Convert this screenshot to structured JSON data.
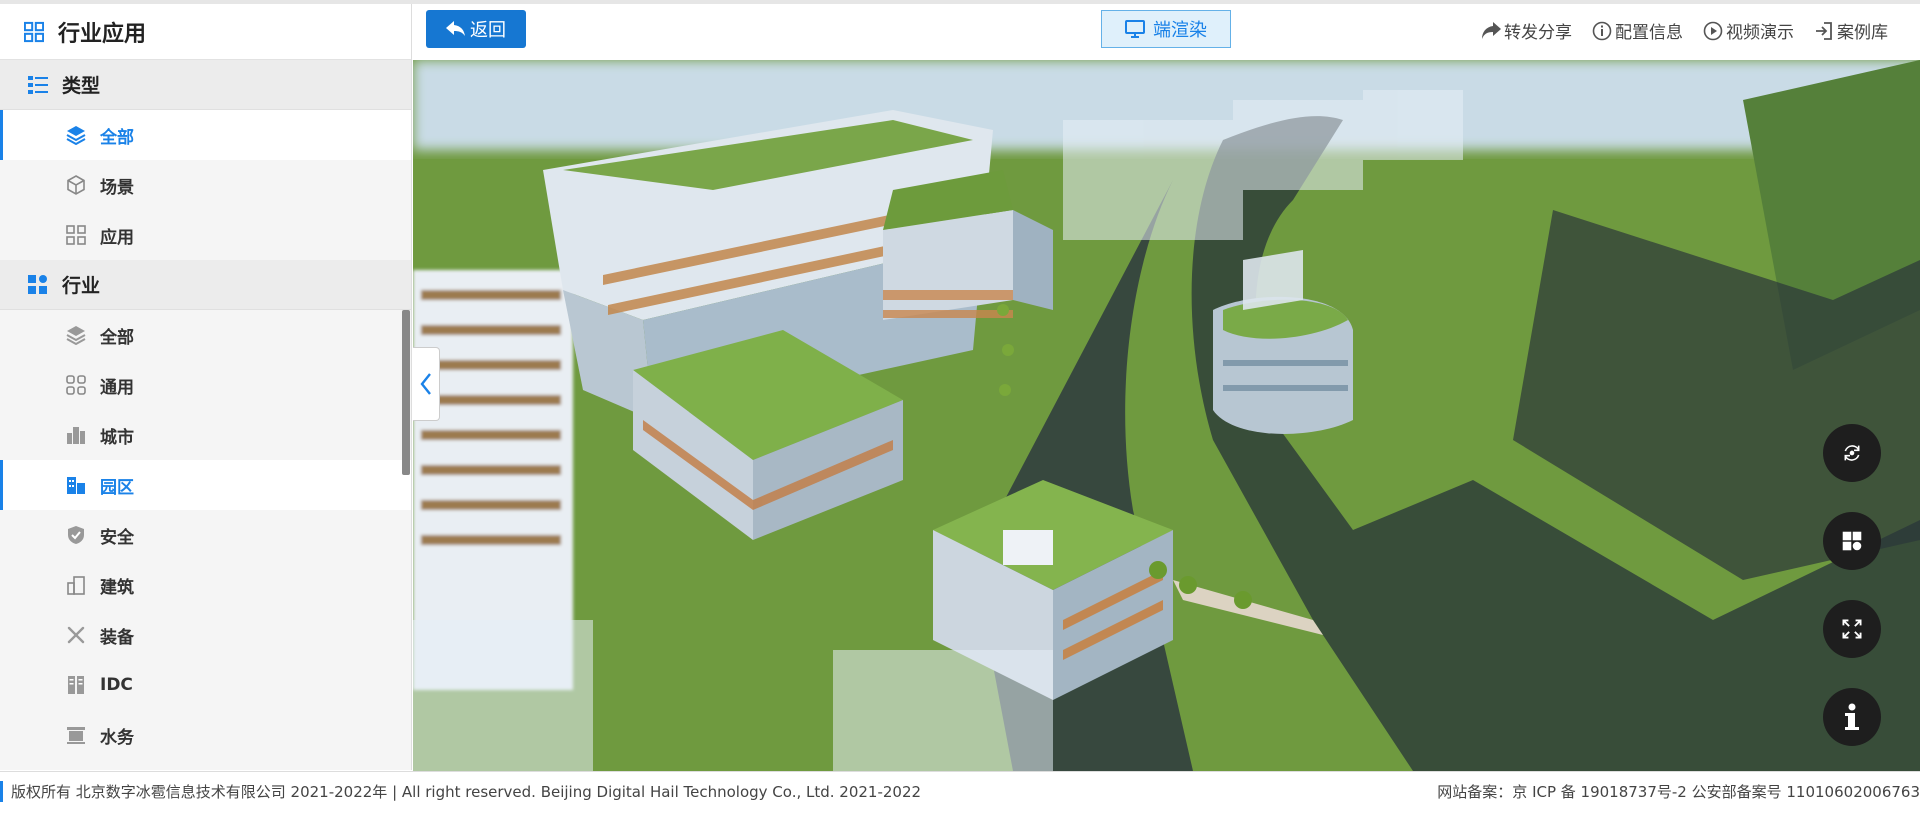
{
  "sidebar": {
    "header_title": "行业应用",
    "groups": [
      {
        "label": "类型",
        "items": [
          {
            "label": "全部",
            "active": true
          },
          {
            "label": "场景"
          },
          {
            "label": "应用"
          }
        ]
      },
      {
        "label": "行业",
        "items": [
          {
            "label": "全部"
          },
          {
            "label": "通用"
          },
          {
            "label": "城市"
          },
          {
            "label": "园区",
            "active": true
          },
          {
            "label": "安全"
          },
          {
            "label": "建筑"
          },
          {
            "label": "装备"
          },
          {
            "label": "IDC"
          },
          {
            "label": "水务"
          }
        ]
      }
    ]
  },
  "topbar": {
    "back_label": "返回",
    "render_label": "端渲染",
    "links": [
      "转发分享",
      "配置信息",
      "视频演示",
      "案例库"
    ]
  },
  "footer": {
    "copyright": "版权所有 北京数字冰雹信息技术有限公司 2021-2022年 | All right reserved. Beijing Digital Hail Technology Co., Ltd. 2021-2022",
    "icp": "网站备案：京 ICP 备 19018737号-2 公安部备案号 11010602006763"
  },
  "colors": {
    "accent": "#1a82e8",
    "button": "#1677d2"
  }
}
